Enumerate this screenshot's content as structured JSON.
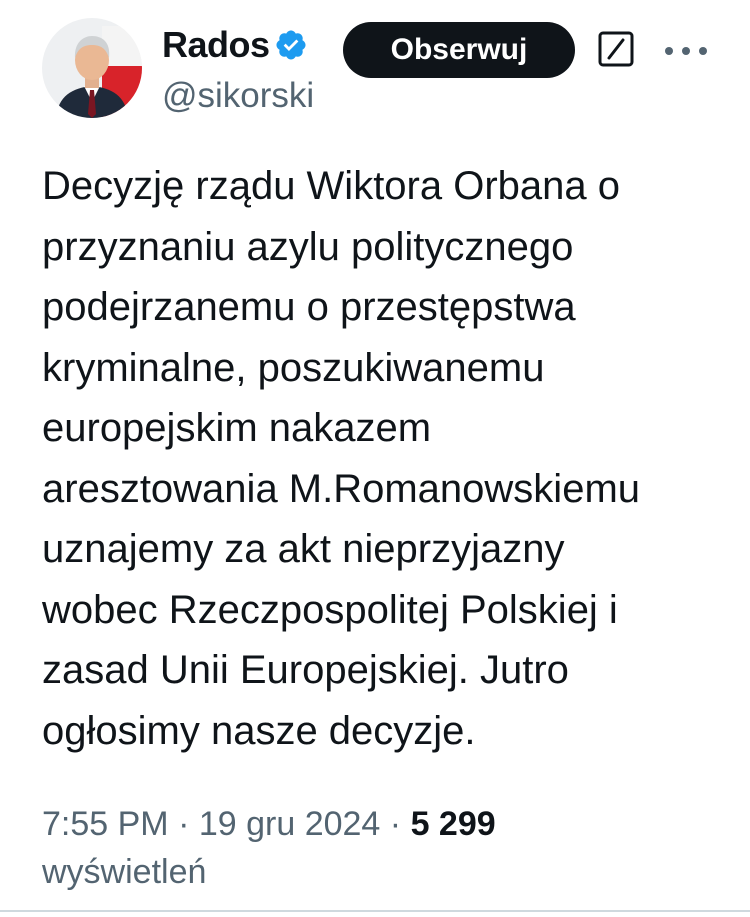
{
  "author": {
    "display_name": "Rados",
    "handle": "@sikorski",
    "verified": true,
    "avatar_icon": "profile-photo"
  },
  "actions": {
    "follow_label": "Obserwuj",
    "grok_icon": "slash-box-icon",
    "more_icon": "ellipsis-icon"
  },
  "tweet": {
    "lines": [
      "Decyzję rządu Wiktora Orbana o",
      "przyznaniu azylu politycznego",
      "podejrzanemu o przestępstwa",
      "kryminalne, poszukiwanemu",
      "europejskim nakazem",
      "aresztowania M.Romanowskiemu",
      "uznajemy za akt nieprzyjazny",
      "wobec Rzeczpospolitej Polskiej i",
      "zasad Unii Europejskiej. Jutro",
      "ogłosimy nasze decyzje."
    ]
  },
  "meta": {
    "time": "7:55 PM",
    "separator": " · ",
    "date": "19 gru 2024",
    "views_count": "5 299",
    "views_label": "wyświetleń"
  },
  "colors": {
    "text_primary": "#0f1419",
    "text_secondary": "#536471",
    "verified_blue": "#1d9bf0",
    "button_bg": "#0f1419",
    "divider": "#cfd9de"
  }
}
